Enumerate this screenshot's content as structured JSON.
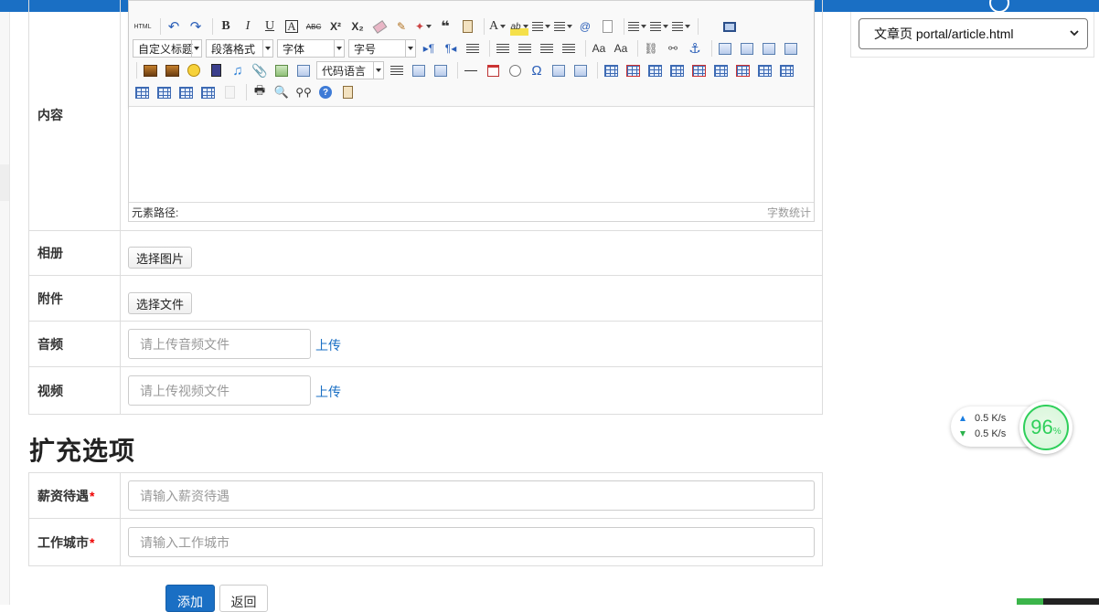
{
  "form": {
    "content_label": "内容",
    "album_label": "相册",
    "album_button": "选择图片",
    "attachment_label": "附件",
    "attachment_button": "选择文件",
    "audio_label": "音频",
    "audio_placeholder": "请上传音频文件",
    "audio_upload": "上传",
    "video_label": "视频",
    "video_placeholder": "请上传视频文件",
    "video_upload": "上传"
  },
  "editor": {
    "html_label": "HTML",
    "custom_title_select": "自定义标题",
    "paragraph_select": "段落格式",
    "font_select": "字体",
    "size_select": "字号",
    "code_lang_select": "代码语言",
    "path_label": "元素路径:",
    "word_count_label": "字数统计"
  },
  "extra": {
    "section_title": "扩充选项",
    "salary_label": "薪资待遇",
    "salary_placeholder": "请输入薪资待遇",
    "city_label": "工作城市",
    "city_placeholder": "请输入工作城市",
    "required_mark": "*"
  },
  "actions": {
    "add_label": "添加",
    "back_label": "返回"
  },
  "template_select": {
    "value": "文章页 portal/article.html"
  },
  "network": {
    "upload_speed": "0.5 K/s",
    "download_speed": "0.5 K/s",
    "gauge_value": "96",
    "gauge_unit": "%"
  },
  "colors": {
    "primary": "#1a6fc4",
    "required": "#ee0000",
    "gauge": "#2ecf5a"
  }
}
